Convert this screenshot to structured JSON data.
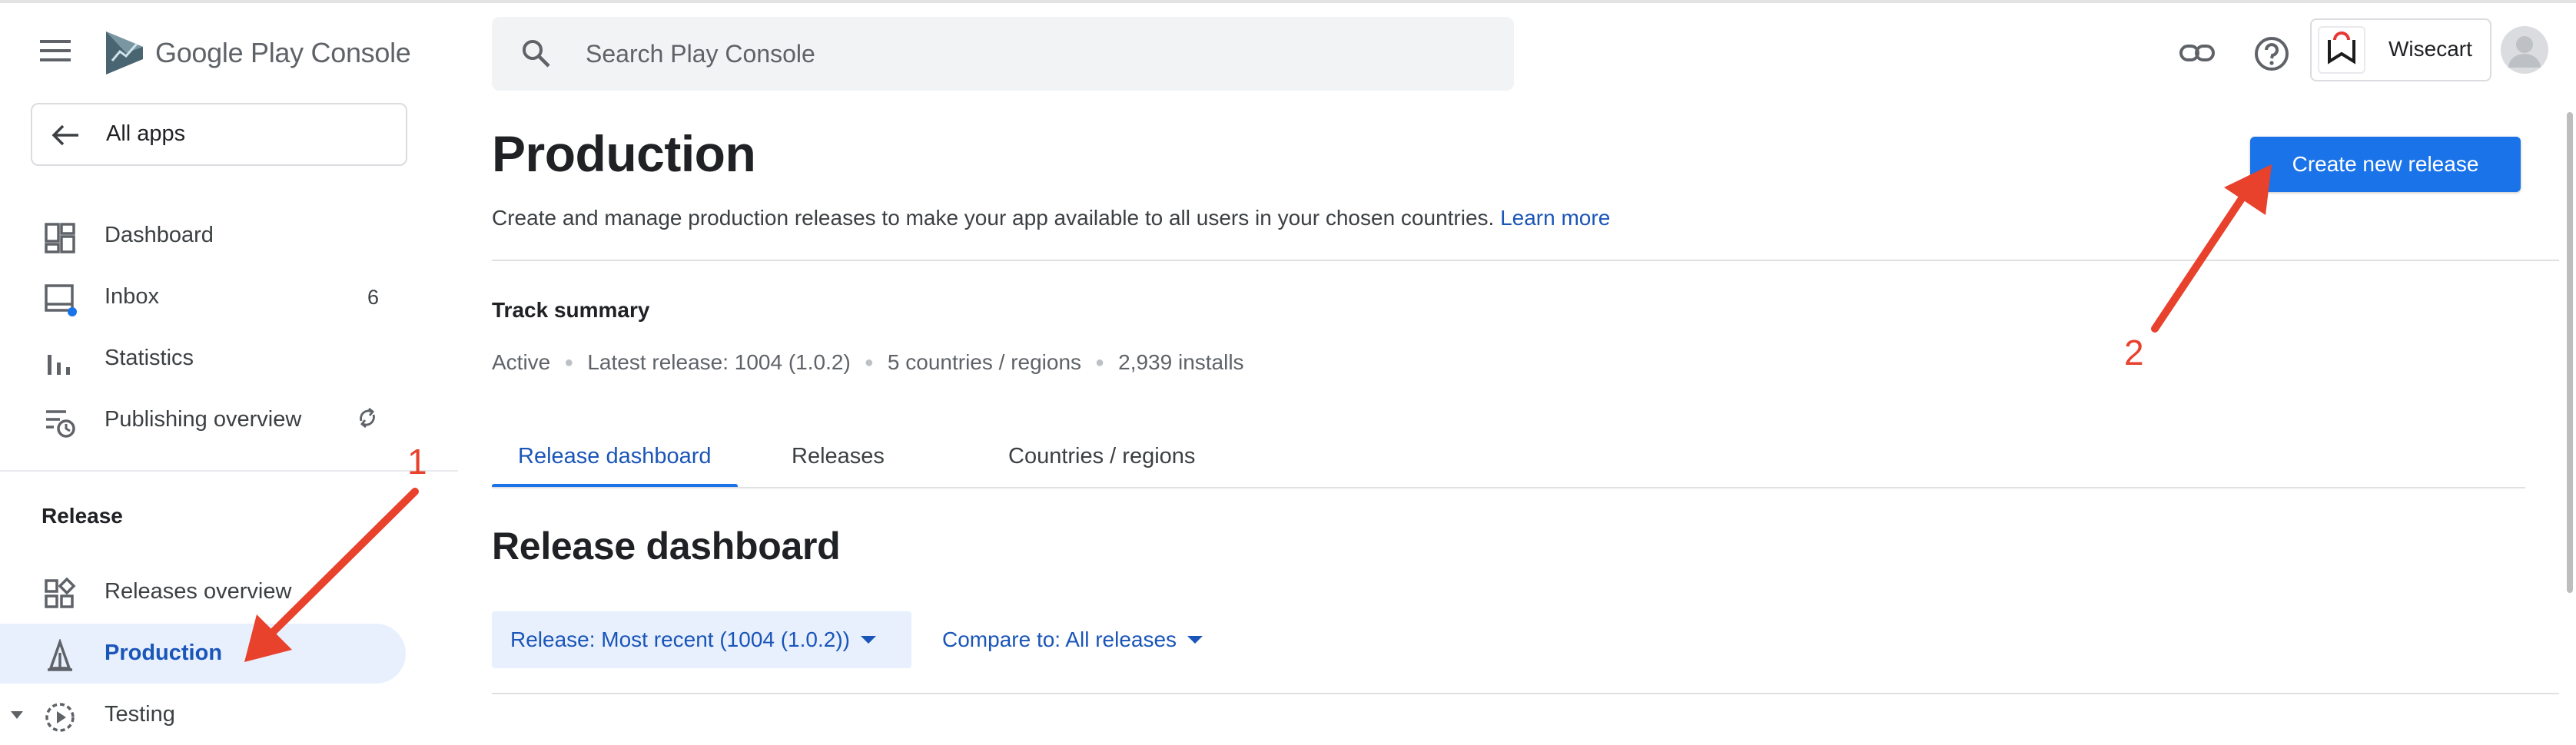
{
  "app": {
    "logo_text": "Google Play Console"
  },
  "search": {
    "placeholder": "Search Play Console"
  },
  "account": {
    "name": "Wisecart"
  },
  "sidebar": {
    "all_apps_label": "All apps",
    "items": [
      {
        "label": "Dashboard",
        "icon": "dashboard-icon"
      },
      {
        "label": "Inbox",
        "icon": "inbox-icon",
        "badge": "6"
      },
      {
        "label": "Statistics",
        "icon": "bar-chart-icon"
      },
      {
        "label": "Publishing overview",
        "icon": "publishing-icon",
        "trailing_icon": "sync-off-icon"
      }
    ],
    "release_section": {
      "heading": "Release",
      "items": [
        {
          "label": "Releases overview",
          "icon": "releases-overview-icon"
        },
        {
          "label": "Production",
          "icon": "production-icon",
          "active": true
        },
        {
          "label": "Testing",
          "icon": "testing-icon",
          "expandable": true
        }
      ]
    }
  },
  "main": {
    "title": "Production",
    "subtitle": "Create and manage production releases to make your app available to all users in your chosen countries.",
    "learn_more": "Learn more",
    "primary_button": "Create new release",
    "track_summary": {
      "heading": "Track summary",
      "status": "Active",
      "latest_release": "Latest release: 1004 (1.0.2)",
      "countries": "5 countries / regions",
      "installs": "2,939 installs"
    },
    "tabs": [
      {
        "label": "Release dashboard",
        "active": true
      },
      {
        "label": "Releases",
        "active": false
      },
      {
        "label": "Countries / regions",
        "active": false
      }
    ],
    "section_title": "Release dashboard",
    "filters": {
      "release": "Release: Most recent (1004 (1.0.2))",
      "compare": "Compare to: All releases"
    }
  },
  "annotations": {
    "step1": "1",
    "step2": "2",
    "arrow_color": "#e8412c"
  },
  "colors": {
    "accent": "#1a73e8",
    "active_nav_bg": "#e8f0fe",
    "link": "#1a55b8"
  }
}
